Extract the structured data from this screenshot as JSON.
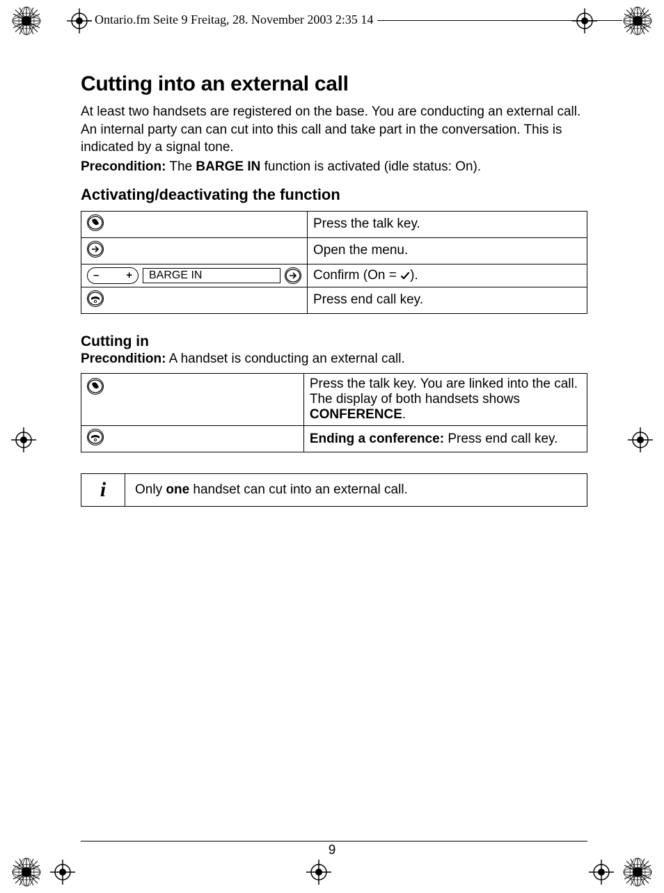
{
  "header": {
    "running_head": "Ontario.fm  Seite 9  Freitag, 28. November 2003  2:35 14"
  },
  "main": {
    "title": "Cutting into an external call",
    "intro": "At least two handsets are registered on the base. You are conducting an external call. An internal party can can cut into this call and take part in the conversation. This is indicated by a signal tone.",
    "precond_label": "Precondition:",
    "precond_text_a": " The ",
    "precond_bold": "BARGE IN",
    "precond_text_b": " function is activated (idle status: On).",
    "section1": {
      "heading": "Activating/deactivating the function",
      "rows": [
        {
          "key_icons": [
            "talk-key-icon"
          ],
          "desc": "Press the talk key."
        },
        {
          "key_icons": [
            "menu-right-icon"
          ],
          "desc": "Open the menu."
        },
        {
          "key_icons": [
            "volume-key-icon",
            "label-box",
            "menu-right-icon"
          ],
          "label": "BARGE IN",
          "desc_pre": "Confirm (On = ",
          "desc_post": ")."
        },
        {
          "key_icons": [
            "end-key-icon"
          ],
          "desc": "Press end call key."
        }
      ]
    },
    "section2": {
      "heading": "Cutting in",
      "precond_label": "Precondition:",
      "precond_text": " A handset is conducting an external call.",
      "rows": [
        {
          "key_icons": [
            "talk-key-icon"
          ],
          "desc_pre": "Press the talk key. You are linked into the call. The display of both handsets shows ",
          "desc_bold": "CONFERENCE",
          "desc_post": "."
        },
        {
          "key_icons": [
            "end-key-icon"
          ],
          "desc_bold_pre": "Ending a conference:",
          "desc_post": " Press end call key."
        }
      ]
    },
    "info": {
      "text_a": "Only ",
      "text_bold": "one",
      "text_b": " handset can cut into an external call."
    }
  },
  "page_number": "9",
  "icons": {
    "volume_minus": "–",
    "volume_plus": "+"
  }
}
